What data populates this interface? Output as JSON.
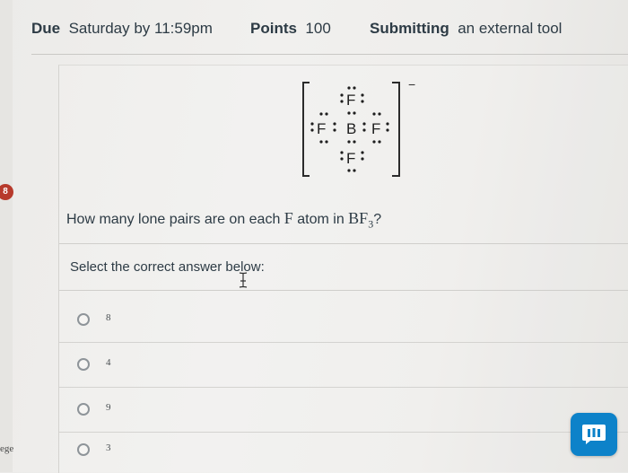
{
  "header": {
    "due_label": "Due",
    "due_value": "Saturday by 11:59pm",
    "points_label": "Points",
    "points_value": "100",
    "submitting_label": "Submitting",
    "submitting_value": "an external tool"
  },
  "sidebar": {
    "badge": "8",
    "partial_label": "ege"
  },
  "question": {
    "lewis_structure": {
      "central_atom": "B",
      "top_atom": "F",
      "left_atom": "F",
      "right_atom": "F",
      "bottom_atom": "F",
      "charge": "−"
    },
    "text_prefix": "How many lone pairs are on each ",
    "text_atom": "F",
    "text_middle": " atom in ",
    "formula_base": "BF",
    "formula_sub": "3",
    "text_suffix": "?",
    "select_prompt": "Select the correct answer below:",
    "answers": [
      {
        "label": "8"
      },
      {
        "label": "4"
      },
      {
        "label": "9"
      },
      {
        "label": "3"
      }
    ]
  },
  "icons": {
    "chat": "chat-icon",
    "cursor": "text-cursor-icon"
  },
  "colors": {
    "badge": "#b73a2c",
    "chat_button": "#0d82c9",
    "text": "#2d3b45"
  }
}
